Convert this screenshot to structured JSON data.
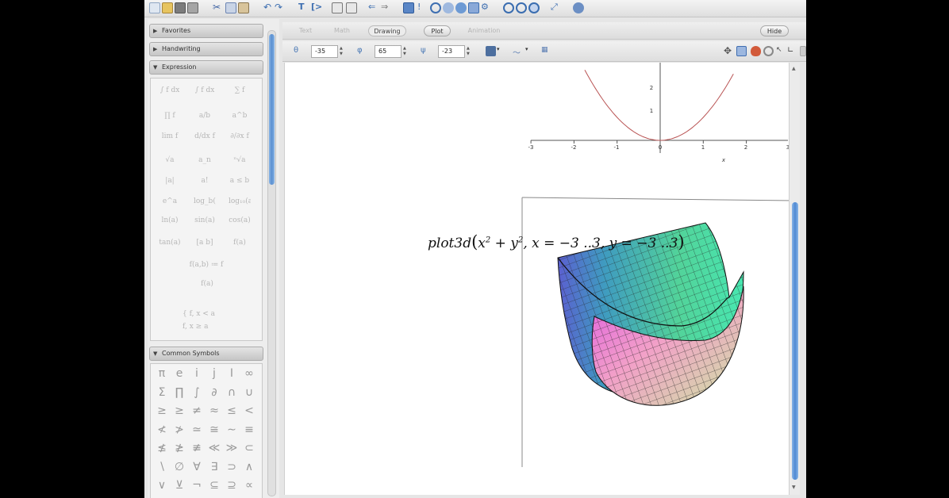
{
  "context_tabs": {
    "text": "Text",
    "math": "Math",
    "drawing": "Drawing",
    "plot": "Plot",
    "animation": "Animation",
    "hide": "Hide"
  },
  "palettes": {
    "favorites": "Favorites",
    "handwriting": "Handwriting",
    "expression": "Expression",
    "common_symbols": "Common Symbols"
  },
  "expression_cells": [
    "∫ f dx",
    "∫ f dx",
    "∑ f",
    "∏ f",
    "a/b",
    "a^b",
    "lim f",
    "d/dx f",
    "∂/∂x f",
    "√a",
    "a_n",
    "ⁿ√a",
    "|a|",
    "a!",
    "a ≤ b",
    "e^a",
    "log_b(a)",
    "log₁₀(a)",
    "ln(a)",
    "sin(a)",
    "cos(a)",
    "tan(a)",
    "[a b]",
    "f(a)",
    "f(a,b) ≔ f",
    "f(a)",
    "{ f,  x < a",
    "   f,  x ≥ a"
  ],
  "common_symbols": [
    "π",
    "e",
    "i",
    "j",
    "I",
    "∞",
    "Σ",
    "∏",
    "∫",
    "∂",
    "∩",
    "∪",
    "≥",
    "≥",
    "≠",
    "≈",
    "≤",
    "<",
    "≮",
    "≯",
    "≃",
    "≅",
    "∼",
    "≡",
    "≰",
    "≱",
    "≢",
    "≪",
    "≫",
    "⊂",
    "∖",
    "∅",
    "∀",
    "∃",
    "⊃",
    "∧",
    "∨",
    "⊻",
    "¬",
    "⊆",
    "⊇",
    "∝"
  ],
  "plot_toolbar": {
    "theta": "-35",
    "phi": "65",
    "psi": "-23"
  },
  "plot2d": {
    "x_ticks": [
      "-3",
      "-2",
      "-1",
      "0",
      "1",
      "2",
      "3"
    ],
    "y_ticks": [
      "2",
      "1"
    ],
    "x_label": "x"
  },
  "command": {
    "func": "plot3d",
    "open": "(",
    "expr_a": "x",
    "exp_a": "2",
    "plus": " + ",
    "expr_b": "y",
    "exp_b": "2",
    "rest": ", x = −3 ..3, y = −3 ..3",
    "close": ")"
  },
  "colors": {
    "accent": "#5b8fd0",
    "curve": "#b95454"
  }
}
